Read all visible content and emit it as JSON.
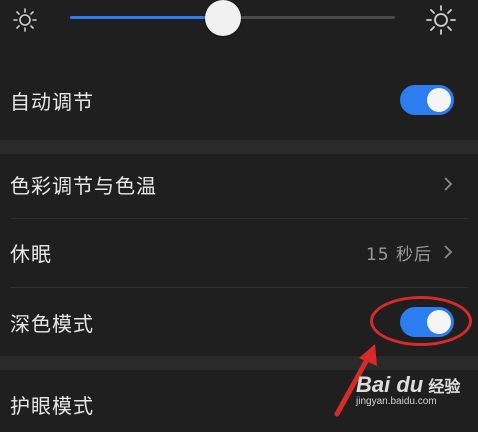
{
  "brightness": {
    "level": 0.47
  },
  "auto_adjust": {
    "label": "自动调节",
    "on": true
  },
  "color_temp": {
    "label": "色彩调节与色温"
  },
  "sleep": {
    "label": "休眠",
    "value": "15 秒后"
  },
  "dark_mode": {
    "label": "深色模式",
    "on": true
  },
  "eye_care": {
    "label": "护眼模式"
  },
  "colors": {
    "accent": "#2b7df0",
    "background": "#1f1f1f",
    "annotation": "#d72a2a"
  },
  "watermark": {
    "logo": "Bai du",
    "cn": "经验",
    "url": "jingyan.baidu.com"
  }
}
